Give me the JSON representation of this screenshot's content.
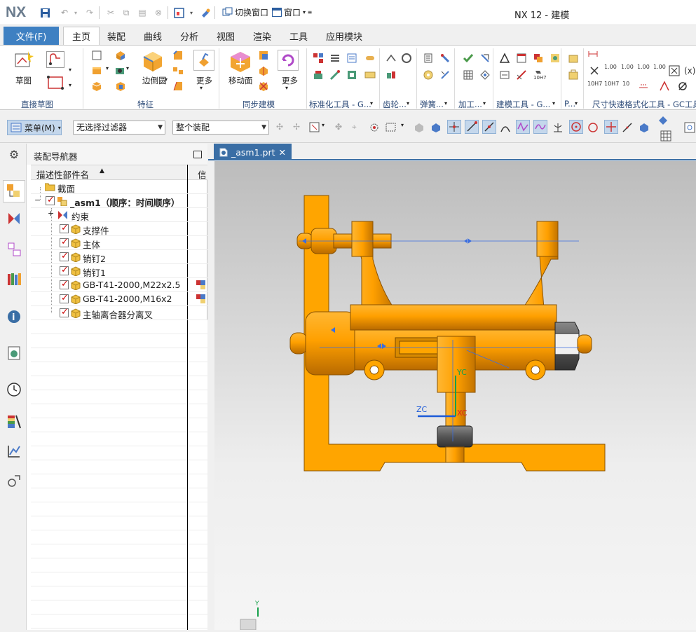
{
  "app": {
    "logo": "NX",
    "title": "NX 12 - 建模"
  },
  "quick_access": {
    "switch_window": "切换窗口",
    "window": "窗口"
  },
  "ribbon_tabs": [
    {
      "label": "文件(F)"
    },
    {
      "label": "主页"
    },
    {
      "label": "装配"
    },
    {
      "label": "曲线"
    },
    {
      "label": "分析"
    },
    {
      "label": "视图"
    },
    {
      "label": "渲染"
    },
    {
      "label": "工具"
    },
    {
      "label": "应用模块"
    }
  ],
  "ribbon": {
    "sketch_label": "草图",
    "edge_blend_label": "边倒圆",
    "more_label_1": "更多",
    "move_face_label": "移动面",
    "more_label_2": "更多",
    "groups": {
      "direct_sketch": "直接草图",
      "feature": "特征",
      "sync_modeling": "同步建模",
      "standard_tools": "标准化工具 - G...",
      "gear": "齿轮...",
      "spring": "弹簧...",
      "machining": "加工...",
      "modeling_tools": "建模工具 - G...",
      "p": "P...",
      "dimension_format": "尺寸快速格式化工具 - GC工具"
    },
    "tolerance_labels": [
      "1.00",
      "1.00",
      "1.00",
      "1.00",
      "10H7",
      "10H7",
      "10"
    ]
  },
  "selection_bar": {
    "menu_label": "菜单(M)",
    "filter_value": "无选择过滤器",
    "scope_value": "整个装配"
  },
  "navigator": {
    "title": "装配导航器",
    "col_name": "描述性部件名",
    "col_info": "信",
    "rows": [
      {
        "label": "截面"
      },
      {
        "label": "_asm1（顺序：时间顺序）"
      },
      {
        "label": "约束"
      },
      {
        "label": "支撑件"
      },
      {
        "label": "主体"
      },
      {
        "label": "销钉2"
      },
      {
        "label": "销钉1"
      },
      {
        "label": "GB-T41-2000,M22x2.5"
      },
      {
        "label": "GB-T41-2000,M16x2"
      },
      {
        "label": "主轴离合器分离叉"
      }
    ]
  },
  "graphics": {
    "tab_label": "_asm1.prt",
    "axis_labels": {
      "zc": "ZC",
      "xc": "XC",
      "yc": "YC",
      "y": "Y"
    }
  },
  "colors": {
    "accent": "#3e80c2",
    "part_orange": "#ffa200",
    "part_dark": "#c87400"
  }
}
